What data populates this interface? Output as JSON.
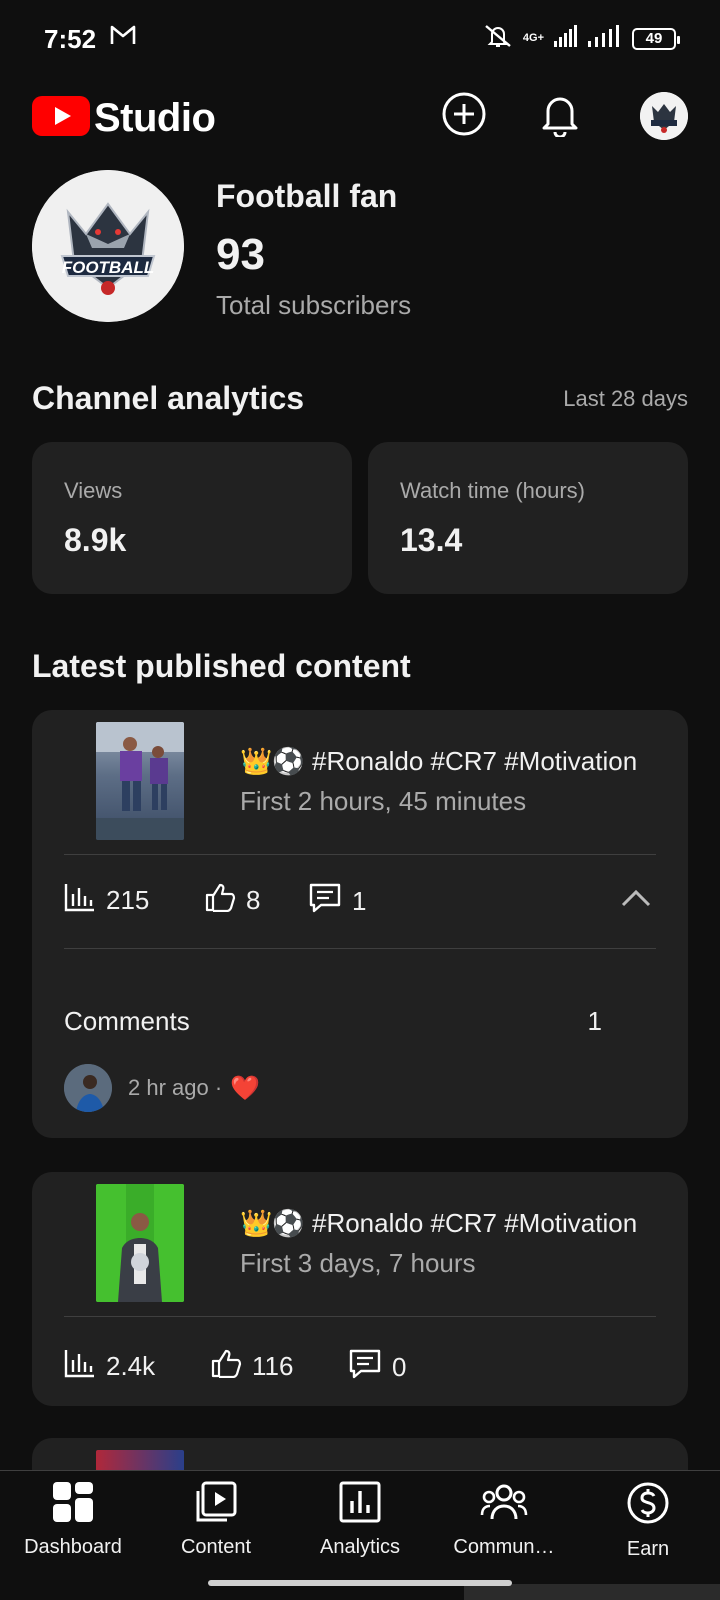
{
  "status_bar": {
    "time": "7:52",
    "network": "4G+",
    "battery": "49"
  },
  "header": {
    "app_name": "Studio",
    "create_icon": "plus-circle-icon",
    "notifications_icon": "bell-icon",
    "brand_color": "#ff0000"
  },
  "channel": {
    "name": "Football fan",
    "subscribers": "93",
    "subscribers_label": "Total subscribers",
    "avatar_text": "FOOTBALL"
  },
  "analytics": {
    "title": "Channel analytics",
    "range": "Last 28 days",
    "cards": [
      {
        "label": "Views",
        "value": "8.9k"
      },
      {
        "label": "Watch time (hours)",
        "value": "13.4"
      }
    ]
  },
  "latest": {
    "title": "Latest published content",
    "items": [
      {
        "emoji": "👑⚽",
        "title": "#Ronaldo #CR7 #Motivation",
        "subtitle": "First 2 hours, 45 minutes",
        "views": "215",
        "likes": "8",
        "comments": "1",
        "comments_label": "Comments",
        "comments_count": "1",
        "comment_meta": "2 hr ago ·",
        "comment_reaction": "❤️"
      },
      {
        "emoji": "👑⚽",
        "title": "#Ronaldo #CR7 #Motivation",
        "subtitle": "First 3 days, 7 hours",
        "views": "2.4k",
        "likes": "116",
        "comments": "0"
      }
    ]
  },
  "nav": {
    "items": [
      {
        "label": "Dashboard",
        "icon": "dashboard-icon"
      },
      {
        "label": "Content",
        "icon": "content-icon"
      },
      {
        "label": "Analytics",
        "icon": "analytics-icon"
      },
      {
        "label": "Commun…",
        "icon": "community-icon"
      },
      {
        "label": "Earn",
        "icon": "earn-icon"
      }
    ]
  }
}
